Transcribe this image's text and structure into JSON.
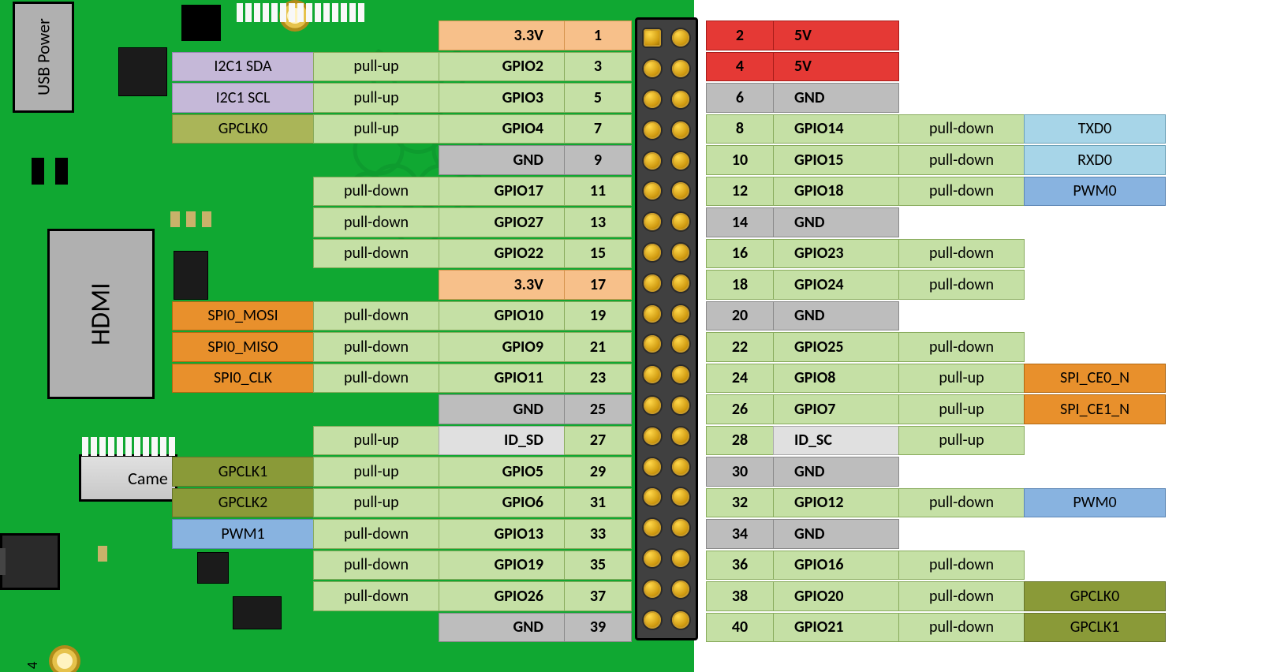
{
  "board": {
    "usb_power_label": "USB\nPower",
    "hdmi_label": "HDMI",
    "camera_label": "Came",
    "page_number": "4"
  },
  "left_pins": [
    {
      "pin": 1,
      "name": "3.3V",
      "name_theme": "t-3v3",
      "pin_theme": "t-3v3"
    },
    {
      "pin": 3,
      "name": "GPIO2",
      "pull": "pull-up",
      "alt": "I2C1 SDA",
      "alt_theme": "t-i2c"
    },
    {
      "pin": 5,
      "name": "GPIO3",
      "pull": "pull-up",
      "alt": "I2C1 SCL",
      "alt_theme": "t-i2c"
    },
    {
      "pin": 7,
      "name": "GPIO4",
      "pull": "pull-up",
      "alt": "GPCLK0",
      "alt_theme": "t-gpclk"
    },
    {
      "pin": 9,
      "name": "GND",
      "name_theme": "t-gnd",
      "pin_theme": "t-gnd"
    },
    {
      "pin": 11,
      "name": "GPIO17",
      "pull": "pull-down"
    },
    {
      "pin": 13,
      "name": "GPIO27",
      "pull": "pull-down"
    },
    {
      "pin": 15,
      "name": "GPIO22",
      "pull": "pull-down"
    },
    {
      "pin": 17,
      "name": "3.3V",
      "name_theme": "t-3v3",
      "pin_theme": "t-3v3"
    },
    {
      "pin": 19,
      "name": "GPIO10",
      "pull": "pull-down",
      "alt": "SPI0_MOSI",
      "alt_theme": "t-spi"
    },
    {
      "pin": 21,
      "name": "GPIO9",
      "pull": "pull-down",
      "alt": "SPI0_MISO",
      "alt_theme": "t-spi"
    },
    {
      "pin": 23,
      "name": "GPIO11",
      "pull": "pull-down",
      "alt": "SPI0_CLK",
      "alt_theme": "t-spi"
    },
    {
      "pin": 25,
      "name": "GND",
      "name_theme": "t-gnd",
      "pin_theme": "t-gnd"
    },
    {
      "pin": 27,
      "name": "ID_SD",
      "name_theme": "t-id",
      "pull": "pull-up"
    },
    {
      "pin": 29,
      "name": "GPIO5",
      "pull": "pull-up",
      "alt": "GPCLK1",
      "alt_theme": "t-gpclk-dark"
    },
    {
      "pin": 31,
      "name": "GPIO6",
      "pull": "pull-up",
      "alt": "GPCLK2",
      "alt_theme": "t-gpclk-dark"
    },
    {
      "pin": 33,
      "name": "GPIO13",
      "pull": "pull-down",
      "alt": "PWM1",
      "alt_theme": "t-pwm"
    },
    {
      "pin": 35,
      "name": "GPIO19",
      "pull": "pull-down"
    },
    {
      "pin": 37,
      "name": "GPIO26",
      "pull": "pull-down"
    },
    {
      "pin": 39,
      "name": "GND",
      "name_theme": "t-gnd",
      "pin_theme": "t-gnd"
    }
  ],
  "right_pins": [
    {
      "pin": 2,
      "name": "5V",
      "name_theme": "t-5v",
      "pin_theme": "t-5v"
    },
    {
      "pin": 4,
      "name": "5V",
      "name_theme": "t-5v",
      "pin_theme": "t-5v"
    },
    {
      "pin": 6,
      "name": "GND",
      "name_theme": "t-gnd",
      "pin_theme": "t-gnd"
    },
    {
      "pin": 8,
      "name": "GPIO14",
      "pull": "pull-down",
      "alt": "TXD0",
      "alt_theme": "t-uart"
    },
    {
      "pin": 10,
      "name": "GPIO15",
      "pull": "pull-down",
      "alt": "RXD0",
      "alt_theme": "t-uart"
    },
    {
      "pin": 12,
      "name": "GPIO18",
      "pull": "pull-down",
      "alt": "PWM0",
      "alt_theme": "t-pwm"
    },
    {
      "pin": 14,
      "name": "GND",
      "name_theme": "t-gnd",
      "pin_theme": "t-gnd"
    },
    {
      "pin": 16,
      "name": "GPIO23",
      "pull": "pull-down"
    },
    {
      "pin": 18,
      "name": "GPIO24",
      "pull": "pull-down"
    },
    {
      "pin": 20,
      "name": "GND",
      "name_theme": "t-gnd",
      "pin_theme": "t-gnd"
    },
    {
      "pin": 22,
      "name": "GPIO25",
      "pull": "pull-down"
    },
    {
      "pin": 24,
      "name": "GPIO8",
      "pull": "pull-up",
      "alt": "SPI_CE0_N",
      "alt_theme": "t-spi"
    },
    {
      "pin": 26,
      "name": "GPIO7",
      "pull": "pull-up",
      "alt": "SPI_CE1_N",
      "alt_theme": "t-spi"
    },
    {
      "pin": 28,
      "name": "ID_SC",
      "name_theme": "t-id",
      "pull": "pull-up"
    },
    {
      "pin": 30,
      "name": "GND",
      "name_theme": "t-gnd",
      "pin_theme": "t-gnd"
    },
    {
      "pin": 32,
      "name": "GPIO12",
      "pull": "pull-down",
      "alt": "PWM0",
      "alt_theme": "t-pwm"
    },
    {
      "pin": 34,
      "name": "GND",
      "name_theme": "t-gnd",
      "pin_theme": "t-gnd"
    },
    {
      "pin": 36,
      "name": "GPIO16",
      "pull": "pull-down"
    },
    {
      "pin": 38,
      "name": "GPIO20",
      "pull": "pull-down",
      "alt": "GPCLK0",
      "alt_theme": "t-gpclk-dark"
    },
    {
      "pin": 40,
      "name": "GPIO21",
      "pull": "pull-down",
      "alt": "GPCLK1",
      "alt_theme": "t-gpclk-dark"
    }
  ]
}
